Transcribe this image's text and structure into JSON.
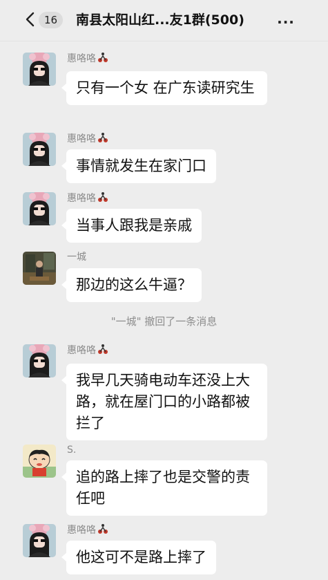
{
  "header": {
    "unread_count": "16",
    "title": "南县太阳山红...友1群(500)",
    "more_label": "..."
  },
  "messages": [
    {
      "sender": "惠咯咯",
      "text": "只有一个女 在广东读研究生",
      "avatar": "girl-avatar"
    },
    {
      "sender": "惠咯咯",
      "text": "事情就发生在家门口",
      "avatar": "girl-avatar"
    },
    {
      "sender": "惠咯咯",
      "text": "当事人跟我是亲戚",
      "avatar": "girl-avatar"
    },
    {
      "sender": "一城",
      "text": "那边的这么牛逼？",
      "avatar": "photo-avatar"
    },
    {
      "sender": "惠咯咯",
      "text": "我早几天骑电动车还没上大路，就在屋门口的小路都被拦了",
      "avatar": "girl-avatar"
    },
    {
      "sender": "S.",
      "text": "追的路上摔了也是交警的责任吧",
      "avatar": "cartoon-avatar"
    },
    {
      "sender": "惠咯咯",
      "text": "他这可不是路上摔了",
      "avatar": "girl-avatar"
    }
  ],
  "system_notice": "\"一城\" 撤回了一条消息",
  "colors": {
    "background": "#ededed",
    "bubble": "#ffffff",
    "sender": "#8a8a8a",
    "system": "#8d8d8d"
  }
}
